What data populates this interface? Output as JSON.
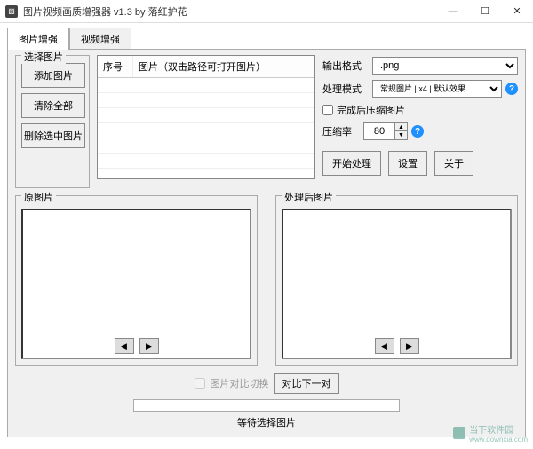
{
  "window": {
    "title": "图片视频画质增强器 v1.3    by 落红护花"
  },
  "tabs": {
    "image": "图片增强",
    "video": "视频增强"
  },
  "select_group": {
    "legend": "选择图片",
    "add": "添加图片",
    "clear": "清除全部",
    "delete": "删除选中图片"
  },
  "list": {
    "col_no": "序号",
    "col_path": "图片（双击路径可打开图片）"
  },
  "opts": {
    "format_label": "输出格式",
    "format_value": ".png",
    "mode_label": "处理模式",
    "mode_value": "常规图片 | x4 | 默认效果",
    "compress_label": "完成后压缩图片",
    "rate_label": "压缩率",
    "rate_value": "80"
  },
  "actions": {
    "start": "开始处理",
    "settings": "设置",
    "about": "关于"
  },
  "preview": {
    "orig": "原图片",
    "done": "处理后图片"
  },
  "compare": {
    "toggle": "图片对比切换",
    "next": "对比下一对"
  },
  "status": "等待选择图片",
  "watermark": {
    "text": "当下软件园",
    "url": "www.downxia.com"
  }
}
